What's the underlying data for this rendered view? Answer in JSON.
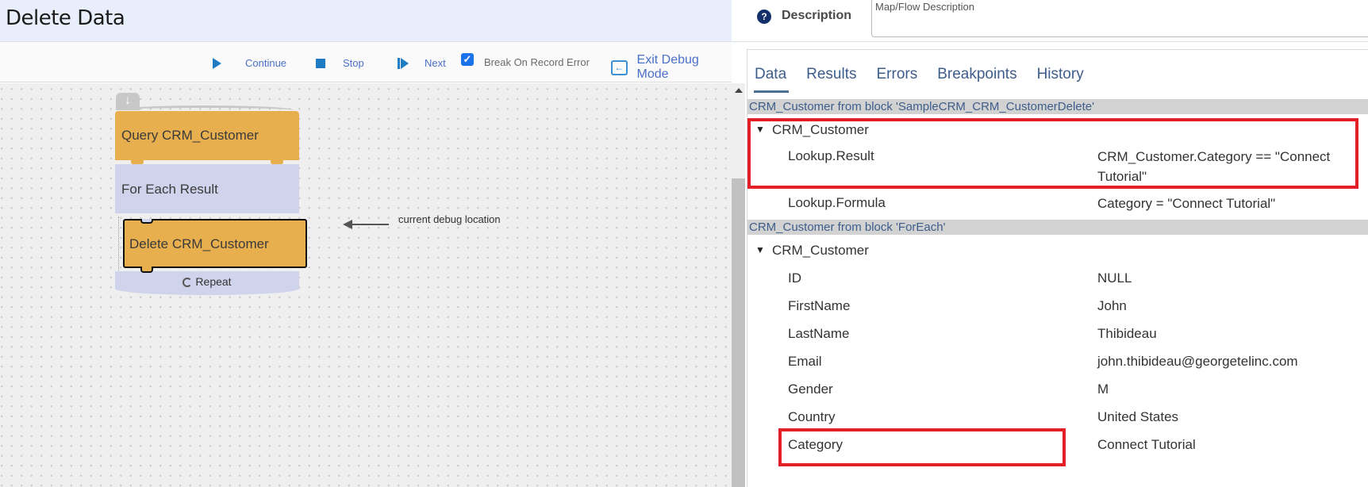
{
  "header": {
    "title": "Delete Data",
    "description_label": "Description",
    "description_placeholder": "Map/Flow Description",
    "help_icon": "question-circle-icon"
  },
  "toolbar": {
    "continue_label": "Continue",
    "stop_label": "Stop",
    "next_label": "Next",
    "break_on_error_label": "Break On Record Error",
    "break_on_error_checked": true,
    "exit_debug_label": "Exit Debug Mode",
    "checkmark": "✓",
    "exit_icon_glyph": "←"
  },
  "canvas": {
    "blocks": [
      {
        "label": "Query CRM_Customer",
        "type": "query"
      },
      {
        "label": "For Each Result",
        "type": "loop"
      },
      {
        "label": "Delete CRM_Customer",
        "type": "delete",
        "current": true
      },
      {
        "label": "Repeat",
        "type": "loop-end"
      }
    ],
    "hat_glyph": "↓",
    "debug_annotation": "current debug location"
  },
  "panel": {
    "tabs": [
      {
        "label": "Data",
        "active": true
      },
      {
        "label": "Results",
        "active": false
      },
      {
        "label": "Errors",
        "active": false
      },
      {
        "label": "Breakpoints",
        "active": false
      },
      {
        "label": "History",
        "active": false
      }
    ],
    "sections": [
      {
        "header": "CRM_Customer from block 'SampleCRM_CRM_CustomerDelete'",
        "node": "CRM_Customer",
        "toggle": "▼",
        "fields": [
          {
            "key": "Lookup.Result",
            "value": "CRM_Customer.Category == \"Connect Tutorial\"",
            "highlighted": true
          },
          {
            "key": "Lookup.Formula",
            "value": "Category = \"Connect Tutorial\""
          }
        ]
      },
      {
        "header": "CRM_Customer from block 'ForEach'",
        "node": "CRM_Customer",
        "toggle": "▼",
        "fields": [
          {
            "key": "ID",
            "value": "NULL"
          },
          {
            "key": "FirstName",
            "value": "John"
          },
          {
            "key": "LastName",
            "value": "Thibideau"
          },
          {
            "key": "Email",
            "value": "john.thibideau@georgetelinc.com"
          },
          {
            "key": "Gender",
            "value": "M"
          },
          {
            "key": "Country",
            "value": "United States"
          },
          {
            "key": "Category",
            "value": "Connect Tutorial",
            "highlighted": true
          }
        ]
      }
    ]
  },
  "colors": {
    "accent": "#1d7cc2",
    "block_orange": "#e8af4f",
    "block_lavender": "#cfd3ec",
    "highlight_red": "#e41e26",
    "header_bg": "#e8eefb"
  }
}
